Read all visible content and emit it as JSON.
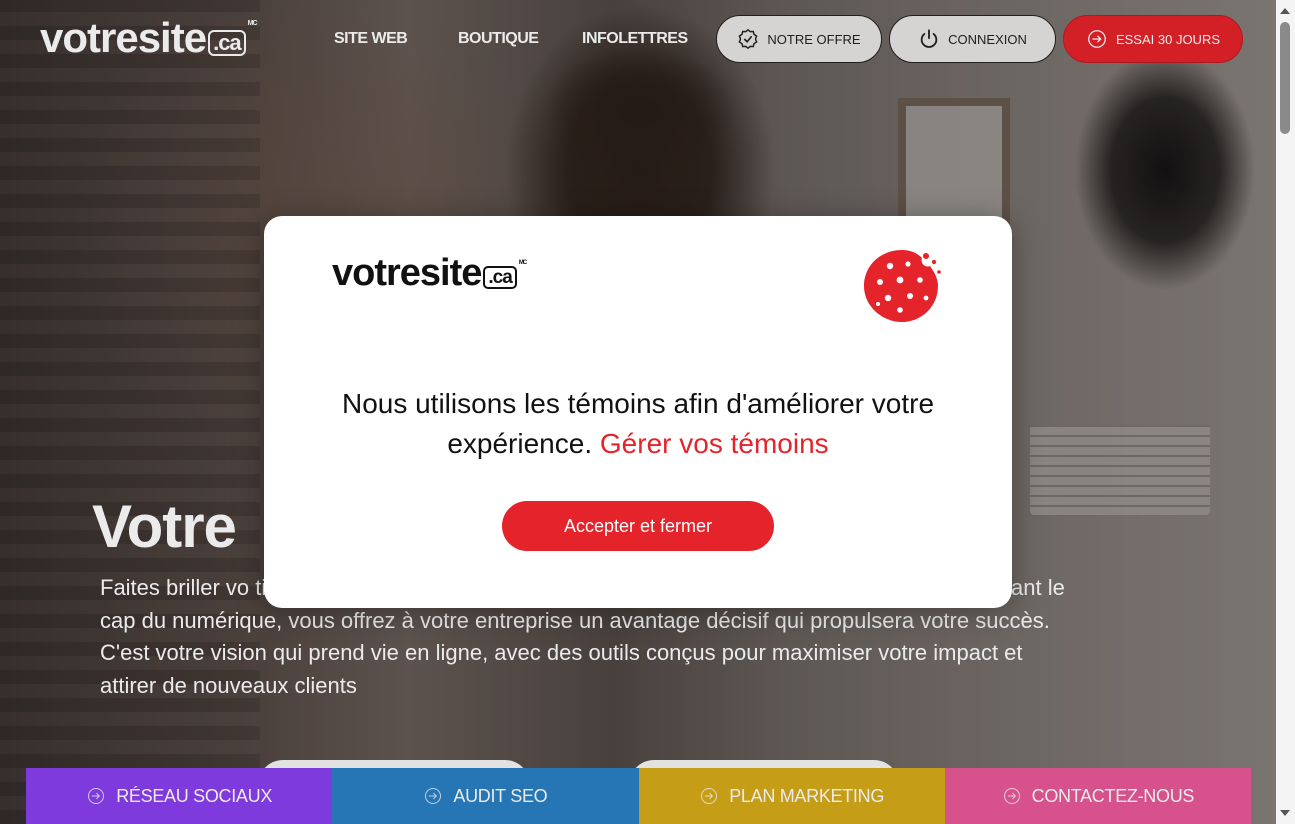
{
  "header": {
    "logo_main": "votresite",
    "logo_ext": ".ca",
    "logo_mark": "MC",
    "nav": [
      "SITE WEB",
      "BOUTIQUE",
      "INFOLETTRES"
    ],
    "offer_label": "NOTRE OFFRE",
    "login_label": "CONNEXION",
    "trial_label": "ESSAI 30 JOURS"
  },
  "hero": {
    "title": "Votre",
    "description": "Faites briller vo                                                                                                                         tise pour concevoir un site web professionnel, captivant et fluide. En franchissant le cap du numérique, vous offrez à votre entreprise un avantage décisif qui propulsera votre succès. C'est votre vision qui prend vie en ligne, avec des outils conçus pour maximiser votre impact et attirer de nouveaux clients"
  },
  "cookie_modal": {
    "logo_main": "votresite",
    "logo_ext": ".ca",
    "logo_mark": "MC",
    "message": "Nous utilisons les témoins afin d'améliorer votre expérience.",
    "manage_link": "Gérer vos témoins",
    "accept_label": "Accepter et fermer"
  },
  "bottom_bar": [
    {
      "label": "RÉSEAU SOCIAUX",
      "color": "#8a3ff0"
    },
    {
      "label": "AUDIT SEO",
      "color": "#2a7fc4"
    },
    {
      "label": "PLAN MARKETING",
      "color": "#d7ab1a"
    },
    {
      "label": "CONTACTEZ-NOUS",
      "color": "#ea5a98"
    }
  ],
  "colors": {
    "brand_red": "#e4232a"
  }
}
